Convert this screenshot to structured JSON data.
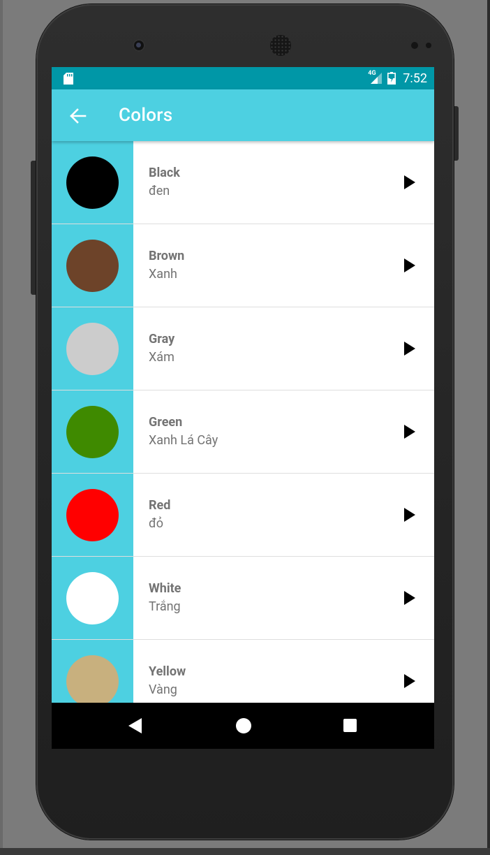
{
  "status_bar": {
    "network": "4G",
    "time": "7:52",
    "icons": [
      "sd-card-icon",
      "signal-4g-icon",
      "battery-charging-icon"
    ]
  },
  "app_bar": {
    "title": "Colors",
    "back_icon": "arrow-back-icon"
  },
  "colors": [
    {
      "name": "Black",
      "translation": "đen",
      "swatch": "#000000"
    },
    {
      "name": "Brown",
      "translation": "Xanh",
      "swatch": "#6d4329"
    },
    {
      "name": "Gray",
      "translation": "Xám",
      "swatch": "#cccccc"
    },
    {
      "name": "Green",
      "translation": "Xanh Lá Cây",
      "swatch": "#3f8a00"
    },
    {
      "name": "Red",
      "translation": "đỏ",
      "swatch": "#ff0000"
    },
    {
      "name": "White",
      "translation": "Trắng",
      "swatch": "#ffffff"
    },
    {
      "name": "Yellow",
      "translation": "Vàng",
      "swatch": "#c8b07e"
    }
  ],
  "theme": {
    "status_bar": "#0097a7",
    "primary": "#4dd0e1",
    "text_secondary": "#737373"
  },
  "nav_bar": {
    "icons": [
      "nav-back-icon",
      "nav-home-icon",
      "nav-recents-icon"
    ]
  }
}
